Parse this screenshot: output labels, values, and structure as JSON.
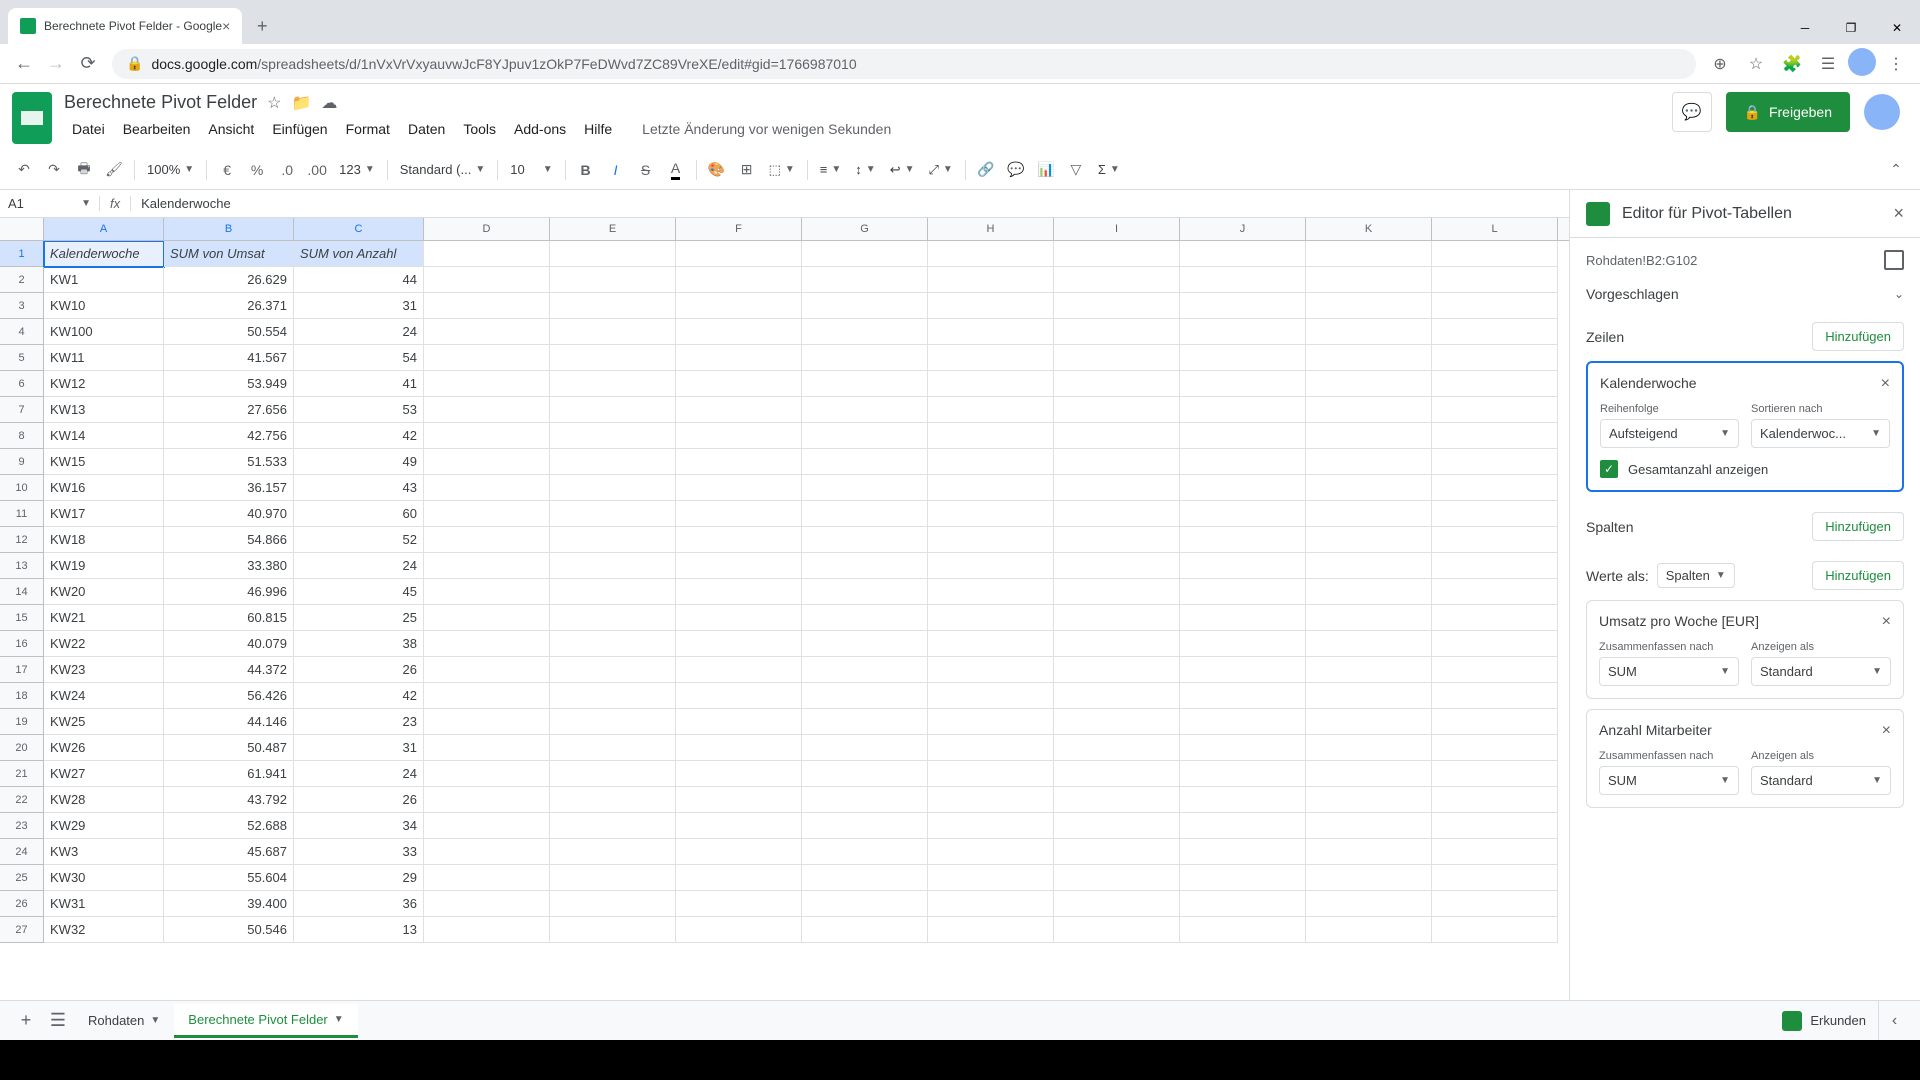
{
  "browser": {
    "tab_title": "Berechnete Pivot Felder - Google",
    "url_prefix": "docs.google.com",
    "url_path": "/spreadsheets/d/1nVxVrVxyauvwJcF8YJpuv1zOkP7FeDWvd7ZC89VreXE/edit#gid=1766987010"
  },
  "docs": {
    "title": "Berechnete Pivot Felder",
    "menus": [
      "Datei",
      "Bearbeiten",
      "Ansicht",
      "Einfügen",
      "Format",
      "Daten",
      "Tools",
      "Add-ons",
      "Hilfe"
    ],
    "last_edit": "Letzte Änderung vor wenigen Sekunden",
    "share": "Freigeben",
    "zoom": "100%",
    "font": "Standard (...",
    "font_size": "10",
    "number_fmt": "123"
  },
  "formula": {
    "name_box": "A1",
    "value": "Kalenderwoche"
  },
  "columns": [
    "A",
    "B",
    "C",
    "D",
    "E",
    "F",
    "G",
    "H",
    "I",
    "J",
    "K",
    "L"
  ],
  "table": {
    "headers": [
      "Kalenderwoche",
      "SUM von Umsat",
      "SUM von Anzahl"
    ],
    "rows": [
      [
        "KW1",
        "26.629",
        "44"
      ],
      [
        "KW10",
        "26.371",
        "31"
      ],
      [
        "KW100",
        "50.554",
        "24"
      ],
      [
        "KW11",
        "41.567",
        "54"
      ],
      [
        "KW12",
        "53.949",
        "41"
      ],
      [
        "KW13",
        "27.656",
        "53"
      ],
      [
        "KW14",
        "42.756",
        "42"
      ],
      [
        "KW15",
        "51.533",
        "49"
      ],
      [
        "KW16",
        "36.157",
        "43"
      ],
      [
        "KW17",
        "40.970",
        "60"
      ],
      [
        "KW18",
        "54.866",
        "52"
      ],
      [
        "KW19",
        "33.380",
        "24"
      ],
      [
        "KW20",
        "46.996",
        "45"
      ],
      [
        "KW21",
        "60.815",
        "25"
      ],
      [
        "KW22",
        "40.079",
        "38"
      ],
      [
        "KW23",
        "44.372",
        "26"
      ],
      [
        "KW24",
        "56.426",
        "42"
      ],
      [
        "KW25",
        "44.146",
        "23"
      ],
      [
        "KW26",
        "50.487",
        "31"
      ],
      [
        "KW27",
        "61.941",
        "24"
      ],
      [
        "KW28",
        "43.792",
        "26"
      ],
      [
        "KW29",
        "52.688",
        "34"
      ],
      [
        "KW3",
        "45.687",
        "33"
      ],
      [
        "KW30",
        "55.604",
        "29"
      ],
      [
        "KW31",
        "39.400",
        "36"
      ],
      [
        "KW32",
        "50.546",
        "13"
      ]
    ]
  },
  "pivot": {
    "title": "Editor für Pivot-Tabellen",
    "range": "Rohdaten!B2:G102",
    "suggested": "Vorgeschlagen",
    "rows_label": "Zeilen",
    "add": "Hinzufügen",
    "row_field": {
      "name": "Kalenderwoche",
      "order_label": "Reihenfolge",
      "order": "Aufsteigend",
      "sort_label": "Sortieren nach",
      "sort": "Kalenderwoc...",
      "show_totals": "Gesamtanzahl anzeigen"
    },
    "cols_label": "Spalten",
    "values_label": "Werte als:",
    "values_mode": "Spalten",
    "value_fields": [
      {
        "name": "Umsatz pro Woche [EUR]",
        "summ_label": "Zusammenfassen nach",
        "summ": "SUM",
        "show_label": "Anzeigen als",
        "show": "Standard"
      },
      {
        "name": "Anzahl Mitarbeiter",
        "summ_label": "Zusammenfassen nach",
        "summ": "SUM",
        "show_label": "Anzeigen als",
        "show": "Standard"
      }
    ]
  },
  "tabs": {
    "sheet1": "Rohdaten",
    "sheet2": "Berechnete Pivot Felder",
    "explore": "Erkunden"
  }
}
